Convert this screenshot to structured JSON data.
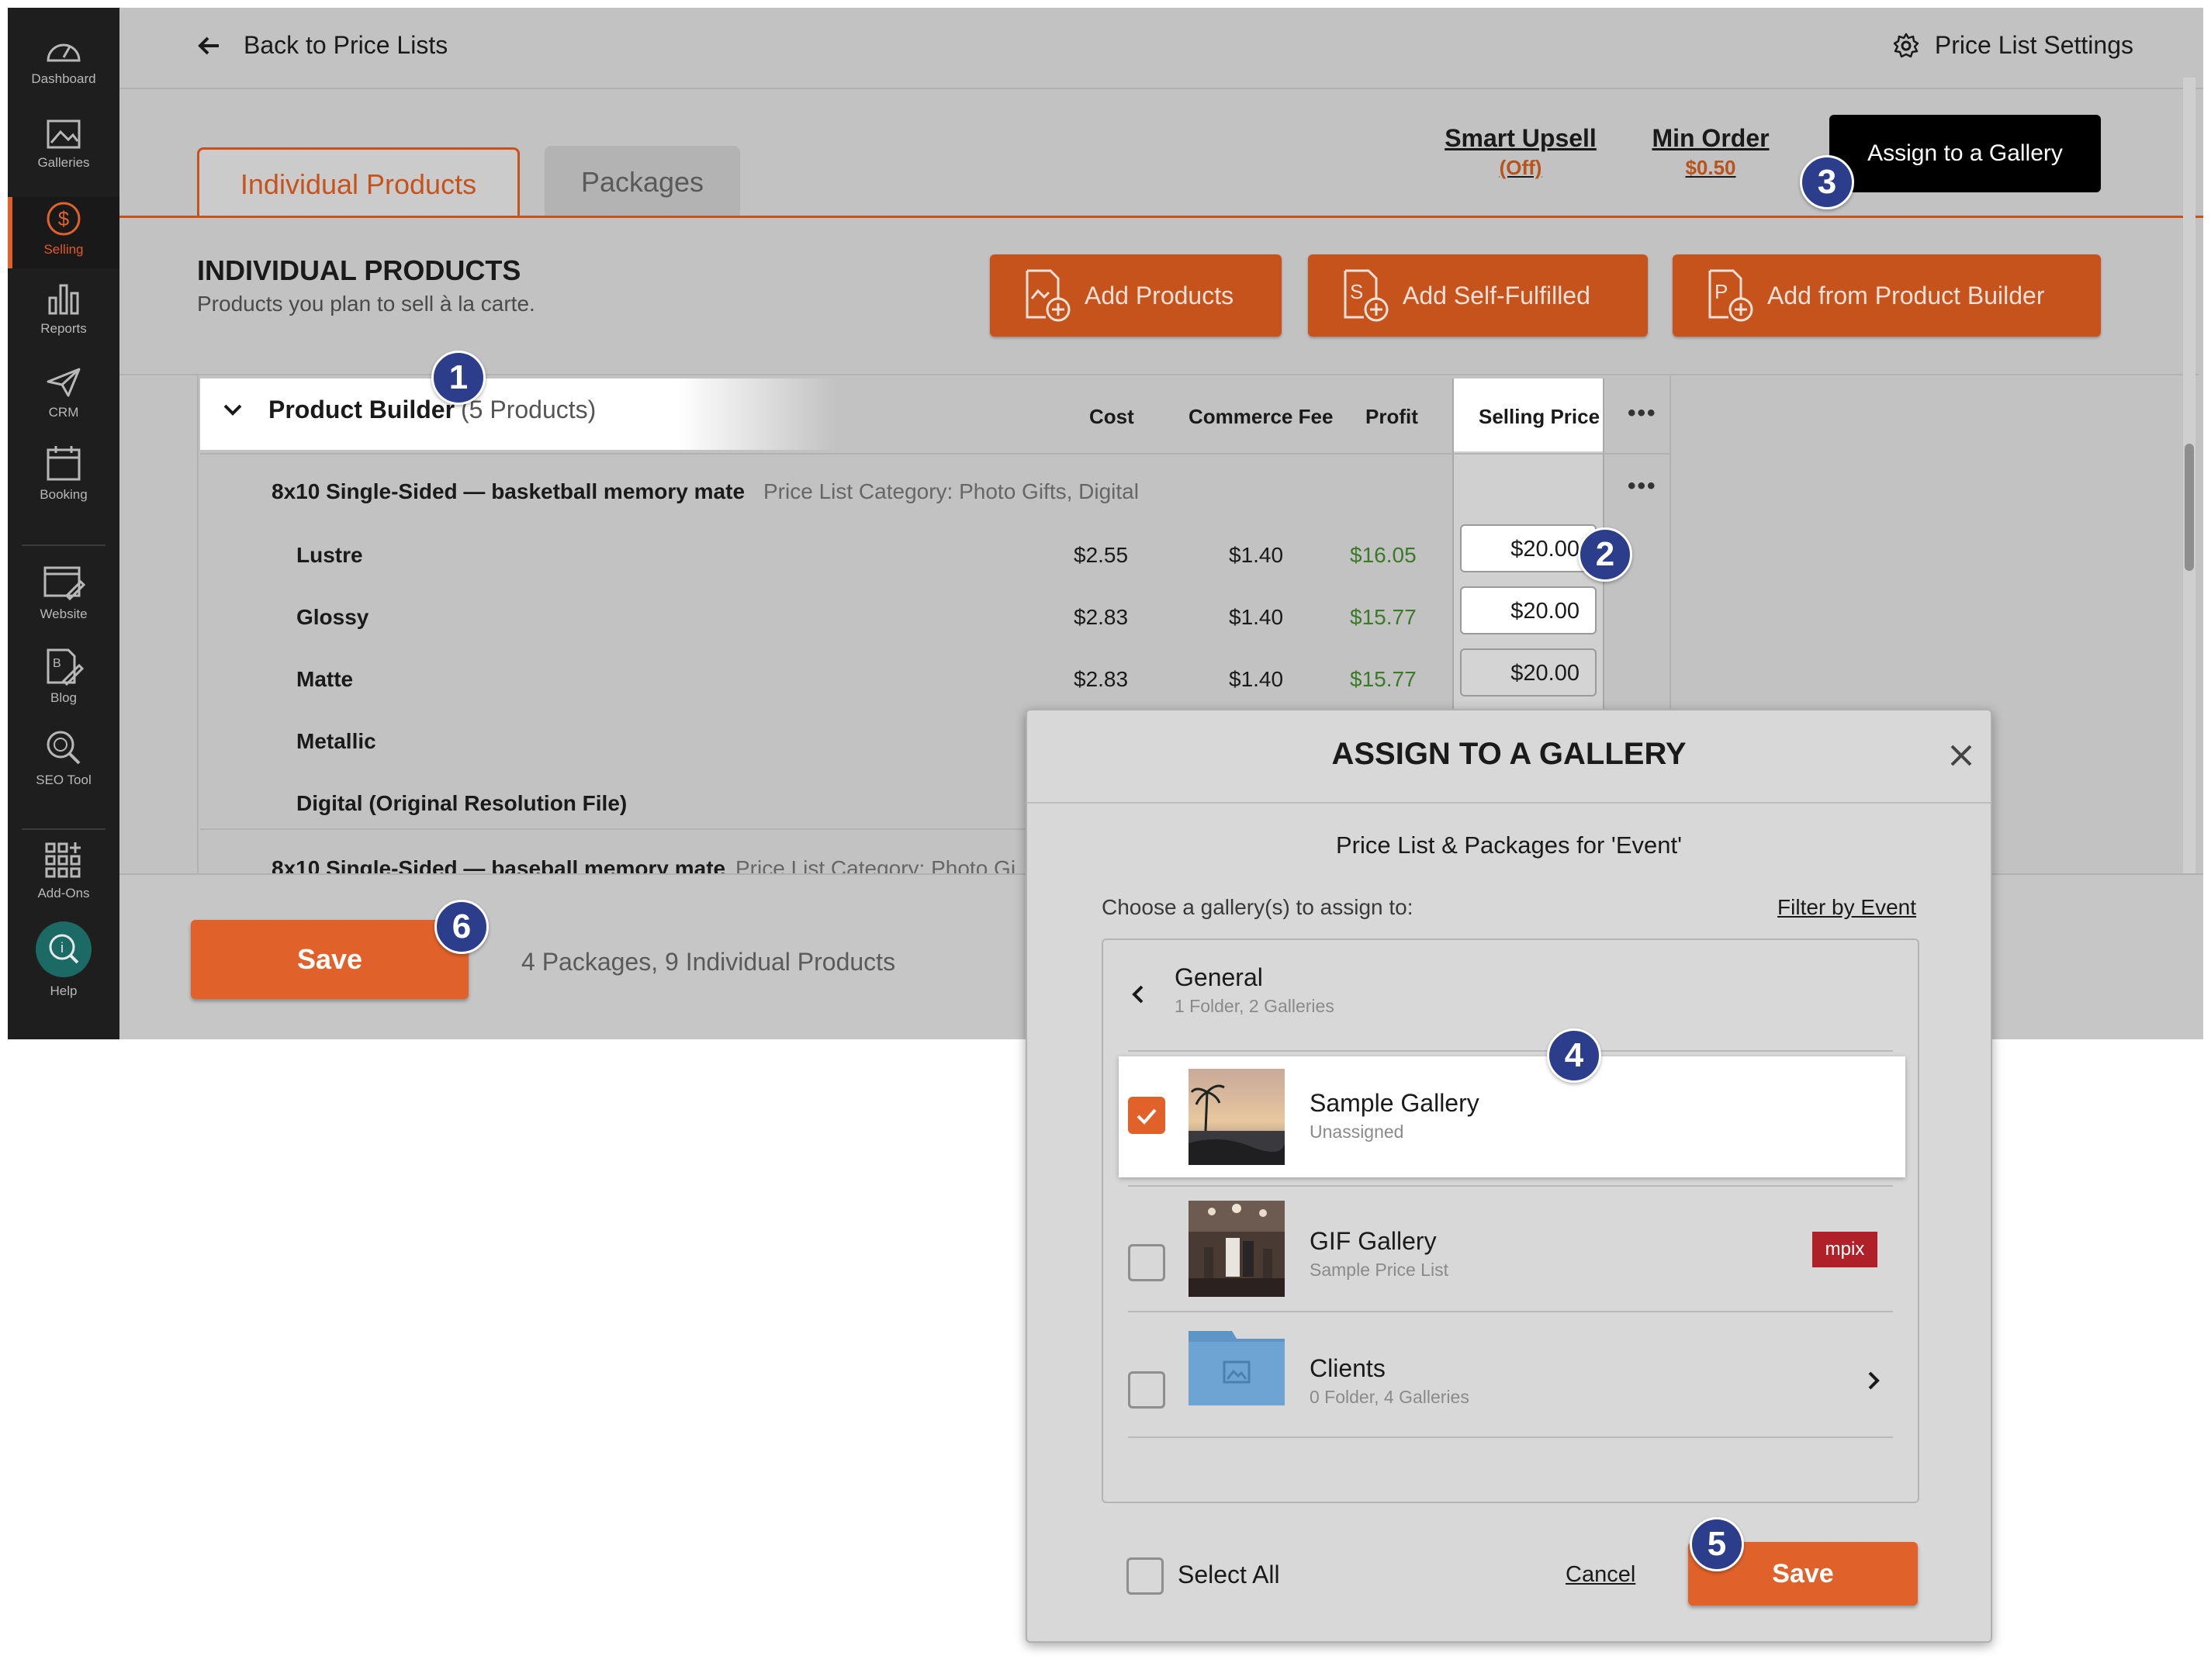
{
  "sidebar": {
    "items": [
      {
        "label": "Dashboard",
        "icon": "dashboard-icon"
      },
      {
        "label": "Galleries",
        "icon": "galleries-icon"
      },
      {
        "label": "Selling",
        "icon": "dollar-icon",
        "active": true
      },
      {
        "label": "Reports",
        "icon": "bar-chart-icon"
      },
      {
        "label": "CRM",
        "icon": "paper-plane-icon"
      },
      {
        "label": "Booking",
        "icon": "calendar-icon"
      },
      {
        "label": "Website",
        "icon": "website-icon"
      },
      {
        "label": "Blog",
        "icon": "blog-icon"
      },
      {
        "label": "SEO Tool",
        "icon": "seo-icon"
      },
      {
        "label": "Add-Ons",
        "icon": "grid-plus-icon"
      },
      {
        "label": "Help",
        "icon": "help-icon"
      }
    ]
  },
  "header": {
    "back_label": "Back to Price Lists",
    "settings_label": "Price List Settings"
  },
  "tabs": [
    {
      "label": "Individual Products",
      "active": true
    },
    {
      "label": "Packages",
      "active": false
    }
  ],
  "toolbar": {
    "smart_upsell": {
      "label": "Smart Upsell",
      "value": "(Off)"
    },
    "min_order": {
      "label": "Min Order",
      "value": "$0.50"
    },
    "assign_label": "Assign to a Gallery"
  },
  "section": {
    "title": "INDIVIDUAL PRODUCTS",
    "subtitle": "Products you plan to sell à la carte.",
    "buttons": {
      "add_products": "Add Products",
      "add_self_fulfilled": "Add Self-Fulfilled",
      "add_from_builder": "Add from Product Builder"
    }
  },
  "table": {
    "group_name": "Product Builder",
    "group_count": "(5 Products)",
    "columns": {
      "cost": "Cost",
      "fee": "Commerce Fee",
      "profit": "Profit",
      "price": "Selling Price"
    },
    "product_name": "8x10 Single-Sided — basketball memory mate",
    "product_category": "Price List Category: Photo Gifts, Digital",
    "rows": [
      {
        "name": "Lustre",
        "cost": "$2.55",
        "fee": "$1.40",
        "profit": "$16.05",
        "price": "$20.00"
      },
      {
        "name": "Glossy",
        "cost": "$2.83",
        "fee": "$1.40",
        "profit": "$15.77",
        "price": "$20.00"
      },
      {
        "name": "Matte",
        "cost": "$2.83",
        "fee": "$1.40",
        "profit": "$15.77",
        "price": "$20.00"
      },
      {
        "name": "Metallic"
      },
      {
        "name": "Digital (Original Resolution File)"
      }
    ],
    "next_product": "8x10 Single-Sided — baseball memory mate",
    "next_category": "Price List Category: Photo Gi"
  },
  "footer": {
    "save_label": "Save",
    "summary": "4 Packages, 9 Individual Products"
  },
  "modal": {
    "title": "ASSIGN TO A GALLERY",
    "subtitle": "Price List & Packages for 'Event'",
    "choose_label": "Choose a gallery(s) to assign to:",
    "filter_label": "Filter by Event",
    "folder": {
      "name": "General",
      "meta": "1 Folder, 2 Galleries"
    },
    "galleries": [
      {
        "name": "Sample Gallery",
        "status": "Unassigned",
        "checked": true
      },
      {
        "name": "GIF Gallery",
        "status": "Sample Price List",
        "checked": false,
        "lab": "mpix"
      },
      {
        "name": "Clients",
        "status": "0 Folder, 4 Galleries",
        "checked": false
      }
    ],
    "select_all_label": "Select All",
    "cancel_label": "Cancel",
    "save_label": "Save"
  },
  "step_badges": [
    "1",
    "2",
    "3",
    "4",
    "5",
    "6"
  ],
  "colors": {
    "accent": "#e0622a",
    "badge": "#2c3d8c",
    "sidebar": "#1e1e1e",
    "profit": "#3b7a28",
    "lab_badge": "#b02028"
  }
}
